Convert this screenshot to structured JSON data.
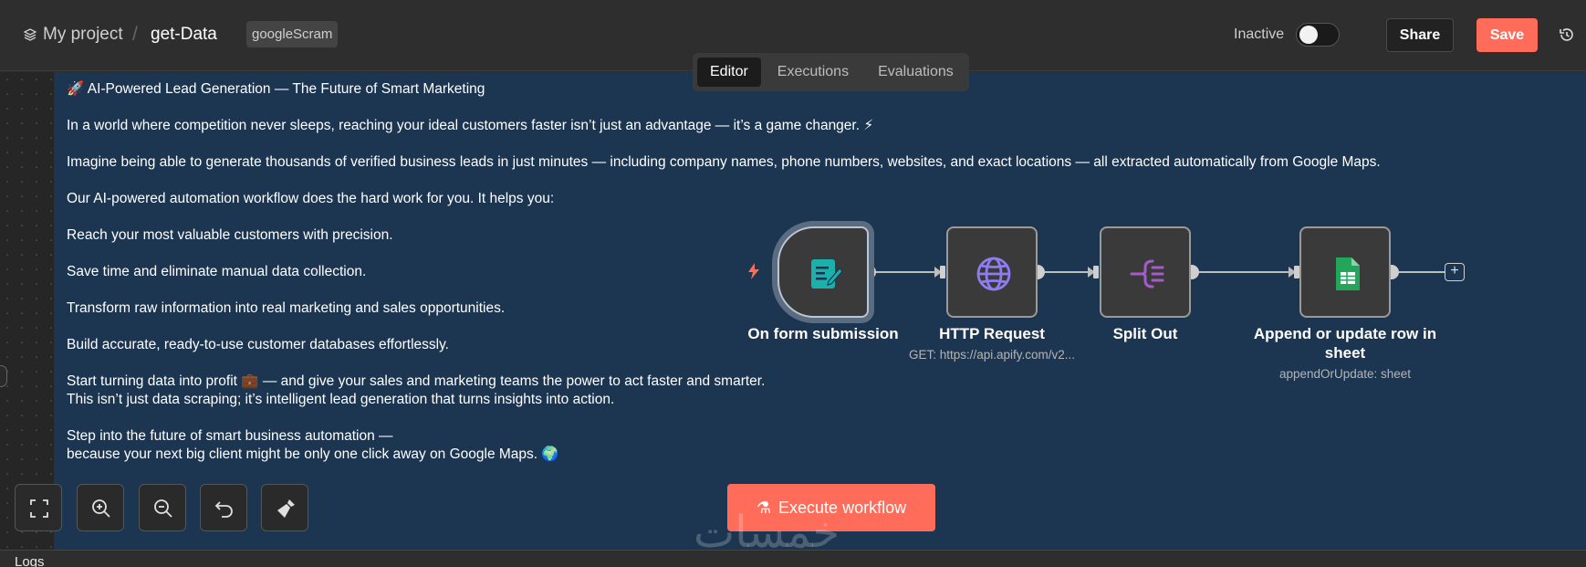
{
  "header": {
    "project_label": "My project",
    "separator": "/",
    "workflow_name": "get-Data",
    "tag": "googleScram",
    "status_label": "Inactive",
    "share_label": "Share",
    "save_label": "Save"
  },
  "tabs": [
    {
      "label": "Editor",
      "active": true
    },
    {
      "label": "Executions",
      "active": false
    },
    {
      "label": "Evaluations",
      "active": false
    }
  ],
  "sticky_note": {
    "lines": [
      "🚀 AI-Powered Lead Generation — The Future of Smart Marketing",
      "In a world where competition never sleeps, reaching your ideal customers faster isn’t just an advantage — it’s a game changer. ⚡",
      "Imagine being able to generate thousands of verified business leads in just minutes — including company names, phone numbers, websites, and exact locations — all extracted automatically from Google Maps.",
      "Our AI-powered automation workflow does the hard work for you. It helps you:",
      "Reach your most valuable customers with precision.",
      "Save time and eliminate manual data collection.",
      "Transform raw information into real marketing and sales opportunities.",
      "Build accurate, ready-to-use customer databases effortlessly.",
      "Start turning data into profit 💼 — and give your sales and marketing teams the power to act faster and smarter.",
      "This isn’t just data scraping; it’s intelligent lead generation that turns insights into action.",
      "Step into the future of smart business automation —",
      "because your next big client might be only one click away on Google Maps. 🌍"
    ]
  },
  "nodes": [
    {
      "label": "On form submission",
      "subtitle": "",
      "icon": "form-icon",
      "color": "#1ab1ad"
    },
    {
      "label": "HTTP Request",
      "subtitle": "GET: https://api.apify.com/v2...",
      "icon": "globe-icon",
      "color": "#8e7cf0"
    },
    {
      "label": "Split Out",
      "subtitle": "",
      "icon": "split-icon",
      "color": "#a35dcb"
    },
    {
      "label": "Append or update row in sheet",
      "subtitle": "appendOrUpdate: sheet",
      "icon": "google-sheets-icon",
      "color": "#23a55a"
    }
  ],
  "execute_label": "Execute workflow",
  "logs_label": "Logs",
  "watermark": "خمسات",
  "colors": {
    "accent": "#ff6d5a",
    "sticky_bg": "#1c3550",
    "canvas_bg": "#262626"
  }
}
